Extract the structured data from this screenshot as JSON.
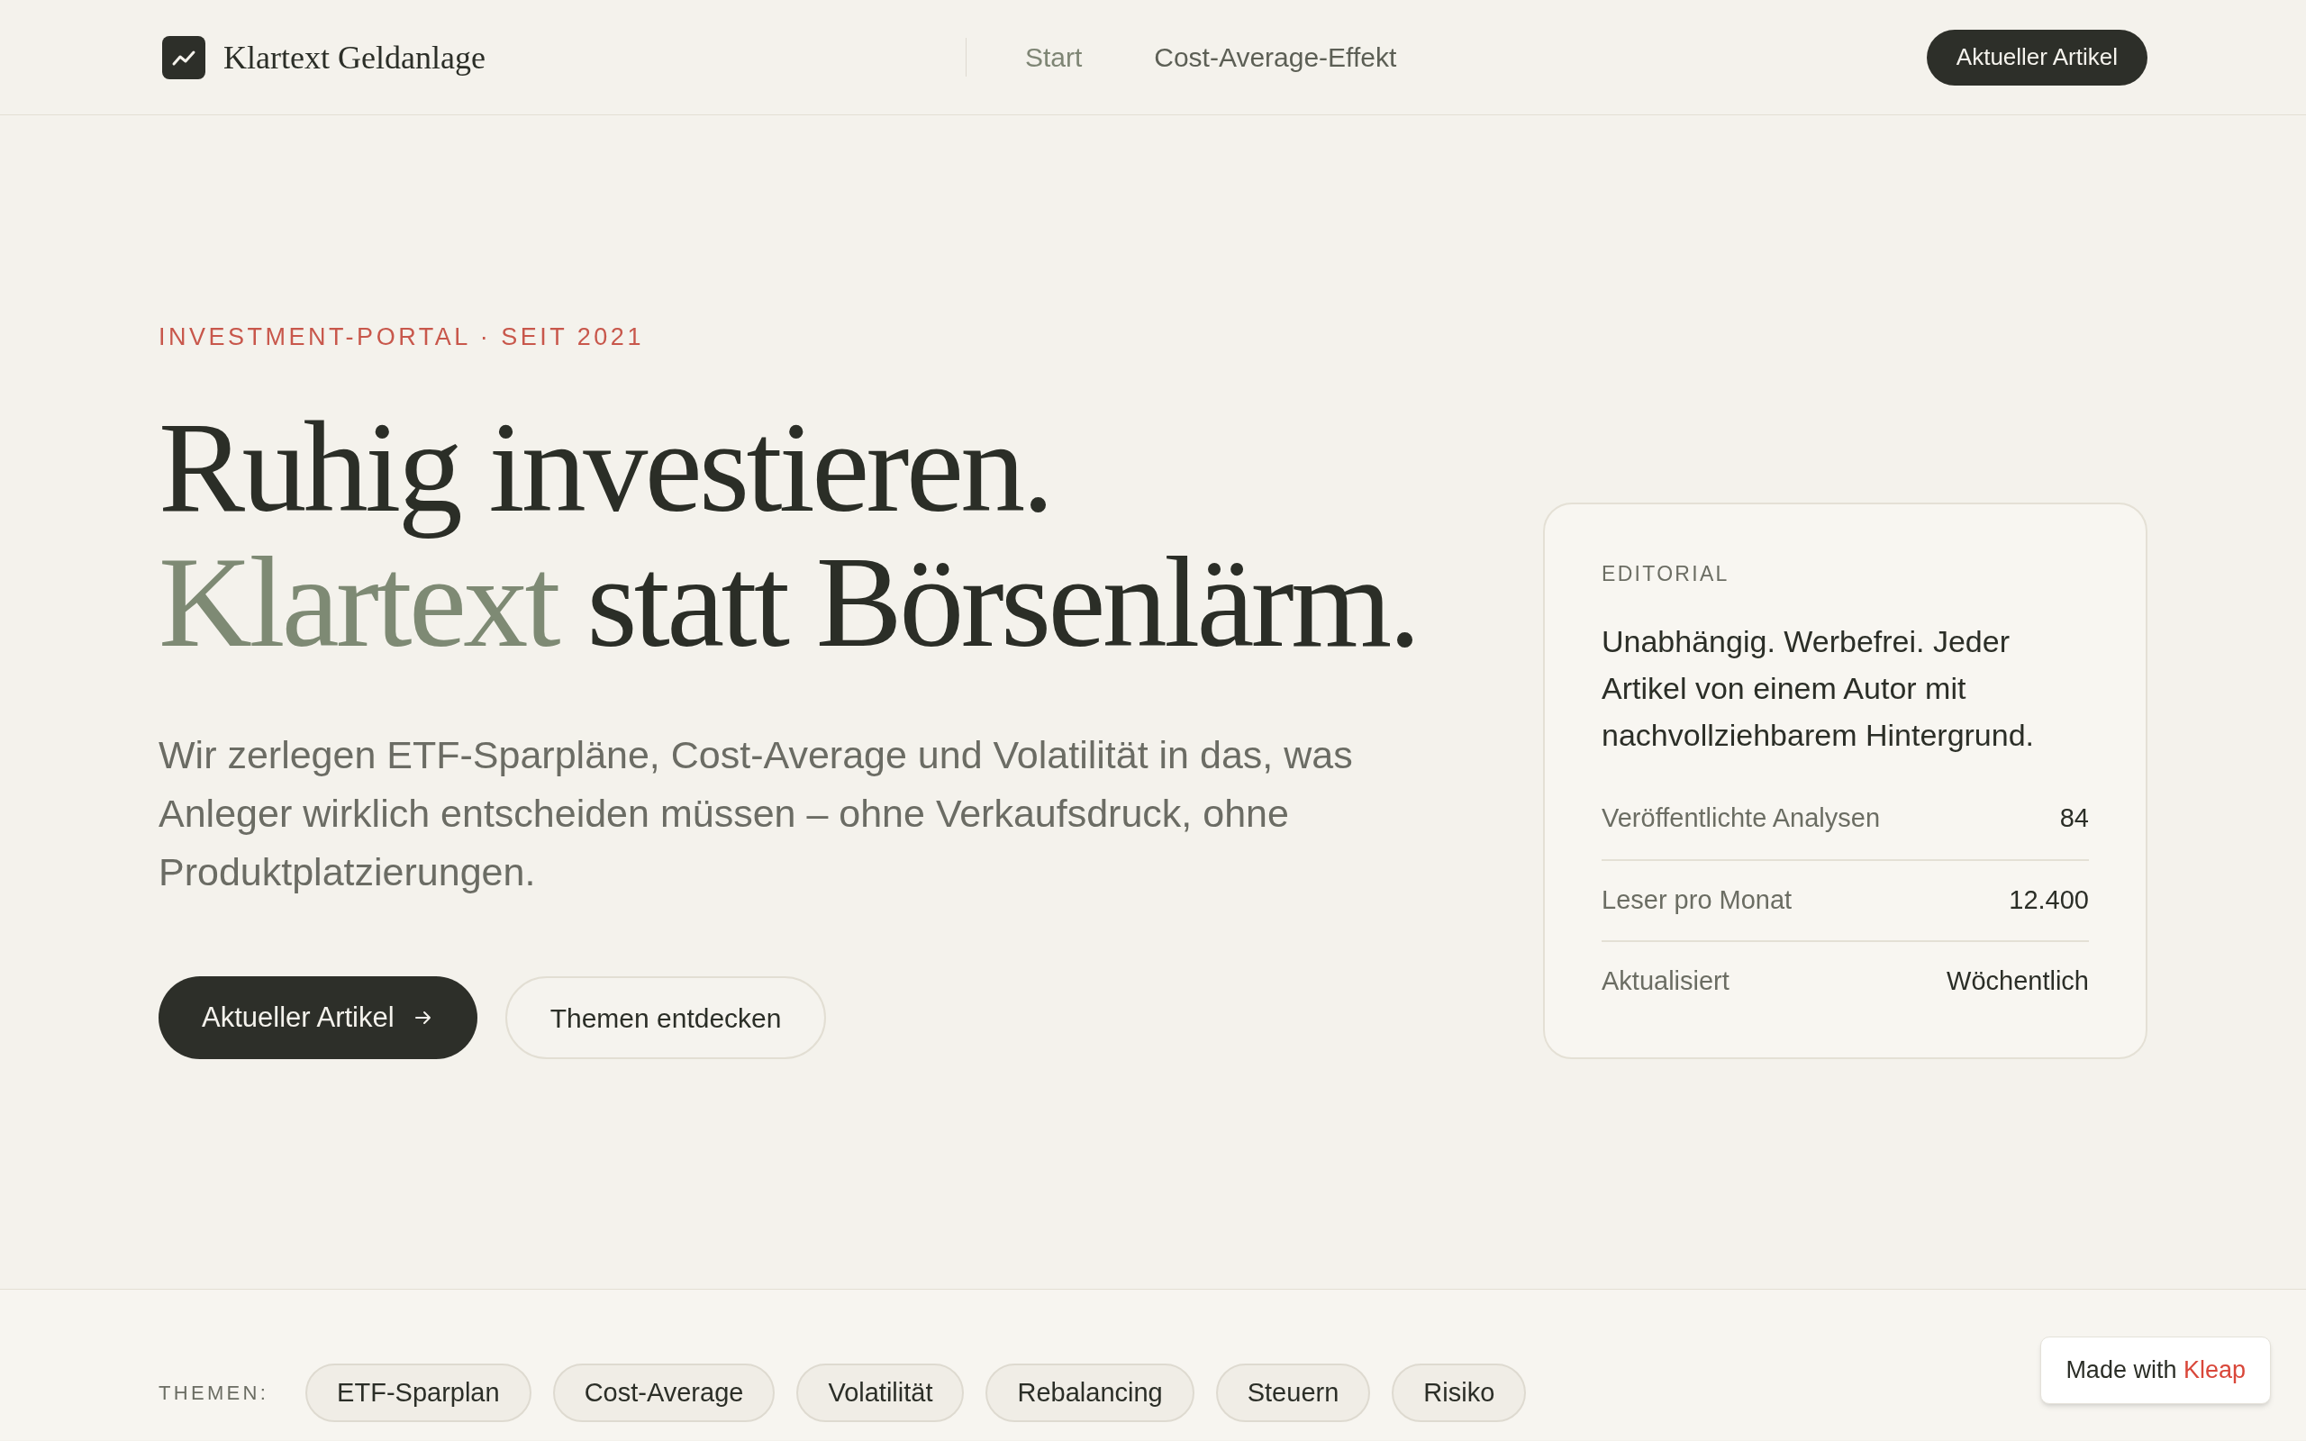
{
  "header": {
    "logo_text": "Klartext Geldanlage",
    "nav": [
      {
        "label": "Start",
        "selected": true
      },
      {
        "label": "Cost-Average-Effekt",
        "selected": false
      }
    ],
    "cta": "Aktueller Artikel"
  },
  "hero": {
    "eyebrow": "INVESTMENT-PORTAL · SEIT 2021",
    "headline": [
      [
        {
          "text": "Ruhig investieren.",
          "accent": false
        }
      ],
      [
        {
          "text": "Klartext",
          "accent": true
        },
        {
          "text": "statt Börsenlärm.",
          "accent": false
        }
      ]
    ],
    "intro": "Wir zerlegen ETF-Sparpläne, Cost-Average und Volatilität in das, was Anleger wirklich entscheiden müssen – ohne Verkaufsdruck, ohne Produktplatzierungen.",
    "buttons": [
      {
        "label": "Aktueller Artikel",
        "kind": "primary"
      },
      {
        "label": "Themen entdecken",
        "kind": "secondary"
      }
    ]
  },
  "editorial_card": {
    "label": "EDITORIAL",
    "text": "Unabhängig. Werbefrei. Jeder Artikel von einem Autor mit nachvollziehbarem Hintergrund.",
    "stats": [
      {
        "label": "Veröffentlichte Analysen",
        "value": "84"
      },
      {
        "label": "Leser pro Monat",
        "value": "12.400"
      },
      {
        "label": "Aktualisiert",
        "value": "Wöchentlich"
      }
    ]
  },
  "topics": {
    "label": "THEMEN:",
    "tags": [
      "ETF-Sparplan",
      "Cost-Average",
      "Volatilität",
      "Rebalancing",
      "Steuern",
      "Risiko"
    ]
  },
  "badge": {
    "text": "Made with",
    "brand": "Kleap"
  }
}
